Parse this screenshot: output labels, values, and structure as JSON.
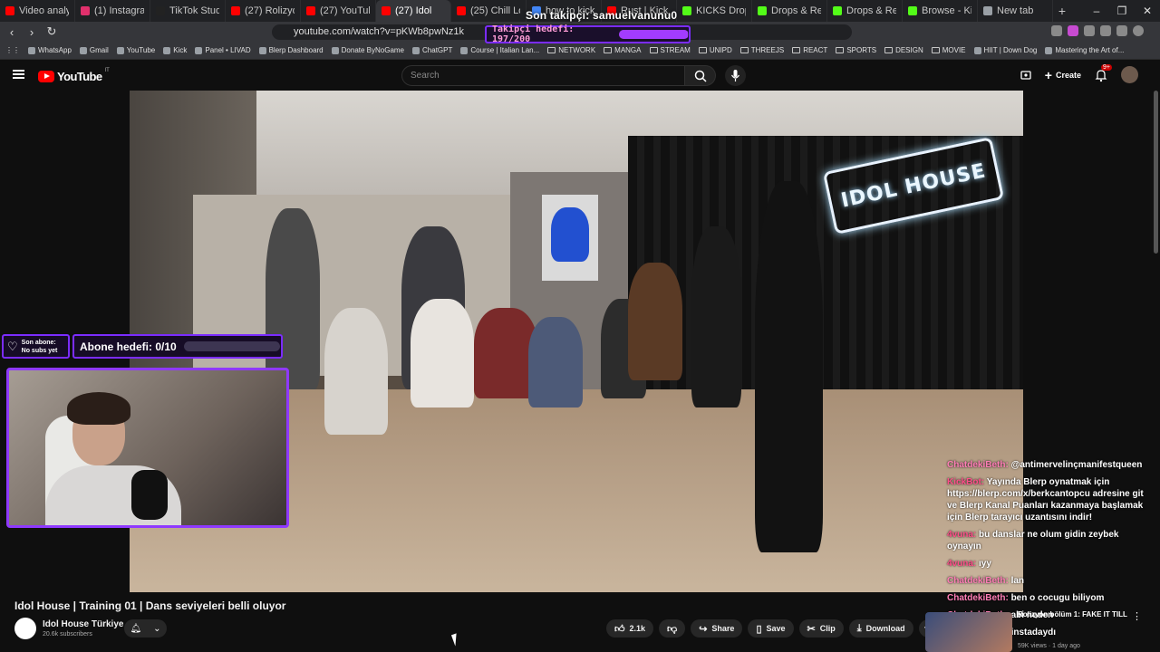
{
  "browser": {
    "tabs": [
      {
        "title": "Video analytics",
        "color": "#ff0000"
      },
      {
        "title": "(1) Instagram",
        "color": "#e1306c"
      },
      {
        "title": "TikTok Studio",
        "color": "#222222"
      },
      {
        "title": "(27) Rolizyon bö",
        "color": "#ff0000"
      },
      {
        "title": "(27) YouTube",
        "color": "#ff0000"
      },
      {
        "title": "(27) Idol",
        "color": "#ff0000",
        "active": true
      },
      {
        "title": "(25) Chill Lofi Mi",
        "color": "#ff0000"
      },
      {
        "title": "how to kick drop",
        "color": "#4285f4"
      },
      {
        "title": "Rust | Kick Drops",
        "color": "#ff0000"
      },
      {
        "title": "KICKS Drop is he",
        "color": "#53fc18"
      },
      {
        "title": "Drops & Reward",
        "color": "#53fc18"
      },
      {
        "title": "Drops & Reward",
        "color": "#53fc18"
      },
      {
        "title": "Browse - Kick Str",
        "color": "#53fc18"
      },
      {
        "title": "New tab",
        "color": "#9aa0a6"
      }
    ],
    "new_tab": "+",
    "url": "youtube.com/watch?v=pKWb8pwNz1k",
    "window_controls": [
      "–",
      "❐",
      "✕"
    ],
    "bookmarks": [
      {
        "label": "WhatsApp",
        "type": "link"
      },
      {
        "label": "Gmail",
        "type": "link"
      },
      {
        "label": "YouTube",
        "type": "link"
      },
      {
        "label": "Kick",
        "type": "link"
      },
      {
        "label": "Panel • LIVAD",
        "type": "link"
      },
      {
        "label": "Blerp Dashboard",
        "type": "link"
      },
      {
        "label": "Donate ByNoGame",
        "type": "link"
      },
      {
        "label": "ChatGPT",
        "type": "link"
      },
      {
        "label": "Course | Italian Lan...",
        "type": "link"
      },
      {
        "label": "NETWORK",
        "type": "folder"
      },
      {
        "label": "MANGA",
        "type": "folder"
      },
      {
        "label": "STREAM",
        "type": "folder"
      },
      {
        "label": "UNIPD",
        "type": "folder"
      },
      {
        "label": "THREEJS",
        "type": "folder"
      },
      {
        "label": "REACT",
        "type": "folder"
      },
      {
        "label": "SPORTS",
        "type": "folder"
      },
      {
        "label": "DESIGN",
        "type": "folder"
      },
      {
        "label": "MOVIE",
        "type": "folder"
      },
      {
        "label": "HIIT | Down Dog",
        "type": "link"
      },
      {
        "label": "Mastering the Art of...",
        "type": "link"
      }
    ]
  },
  "stream_overlay": {
    "last_follower": "Son takipçi: samuelvanunu0",
    "follower_goal": "Takipçi hedefi: 197/200",
    "follower_progress": 0.985,
    "last_sub_title": "Son abone:",
    "last_sub_value": "No subs yet",
    "sub_goal": "Abone hedefi: 0/10",
    "sub_progress": 0
  },
  "youtube": {
    "logo_text": "YouTube",
    "logo_country": "IT",
    "search_placeholder": "Search",
    "create_label": "Create",
    "notif_badge": "9+",
    "neon_sign": "IDOL HOUSE",
    "video_title": "Idol House | Training 01 | Dans seviyeleri belli oluyor",
    "channel_name": "Idol House Türkiye",
    "channel_subs": "20.6k subscribers",
    "actions": {
      "like_count": "2.1k",
      "share": "Share",
      "save": "Save",
      "clip": "Clip",
      "download": "Download"
    },
    "recommended": {
      "title": "Rolizyon bölüm 1: FAKE IT TILL",
      "channel": "Bella's TV",
      "meta": "59K views · 1 day ago"
    }
  },
  "chat": [
    {
      "user": "ChatdekiBeth:",
      "text": "@antimervelinçmanifestqueen"
    },
    {
      "user": "KickBot:",
      "text": "Yayında Blerp oynatmak için https://blerp.com/x/berkcantopcu adresine git ve Blerp Kanal Puanları kazanmaya başlamak için Blerp tarayıcı uzantısını indir!",
      "bot": true
    },
    {
      "user": "4vuna:",
      "text": "bu danslar ne olum gidin zeybek oynayın",
      "red": true
    },
    {
      "user": "4vuna:",
      "text": "ıyy",
      "red": true
    },
    {
      "user": "ChatdekiBeth:",
      "text": "lan"
    },
    {
      "user": "ChatdekiBeth:",
      "text": "ben o cocugu biliyom"
    },
    {
      "user": "ChatdekiBeth:",
      "text": "abi neden"
    },
    {
      "user": "ChatdekiBeth:",
      "text": "instadaydı"
    }
  ]
}
